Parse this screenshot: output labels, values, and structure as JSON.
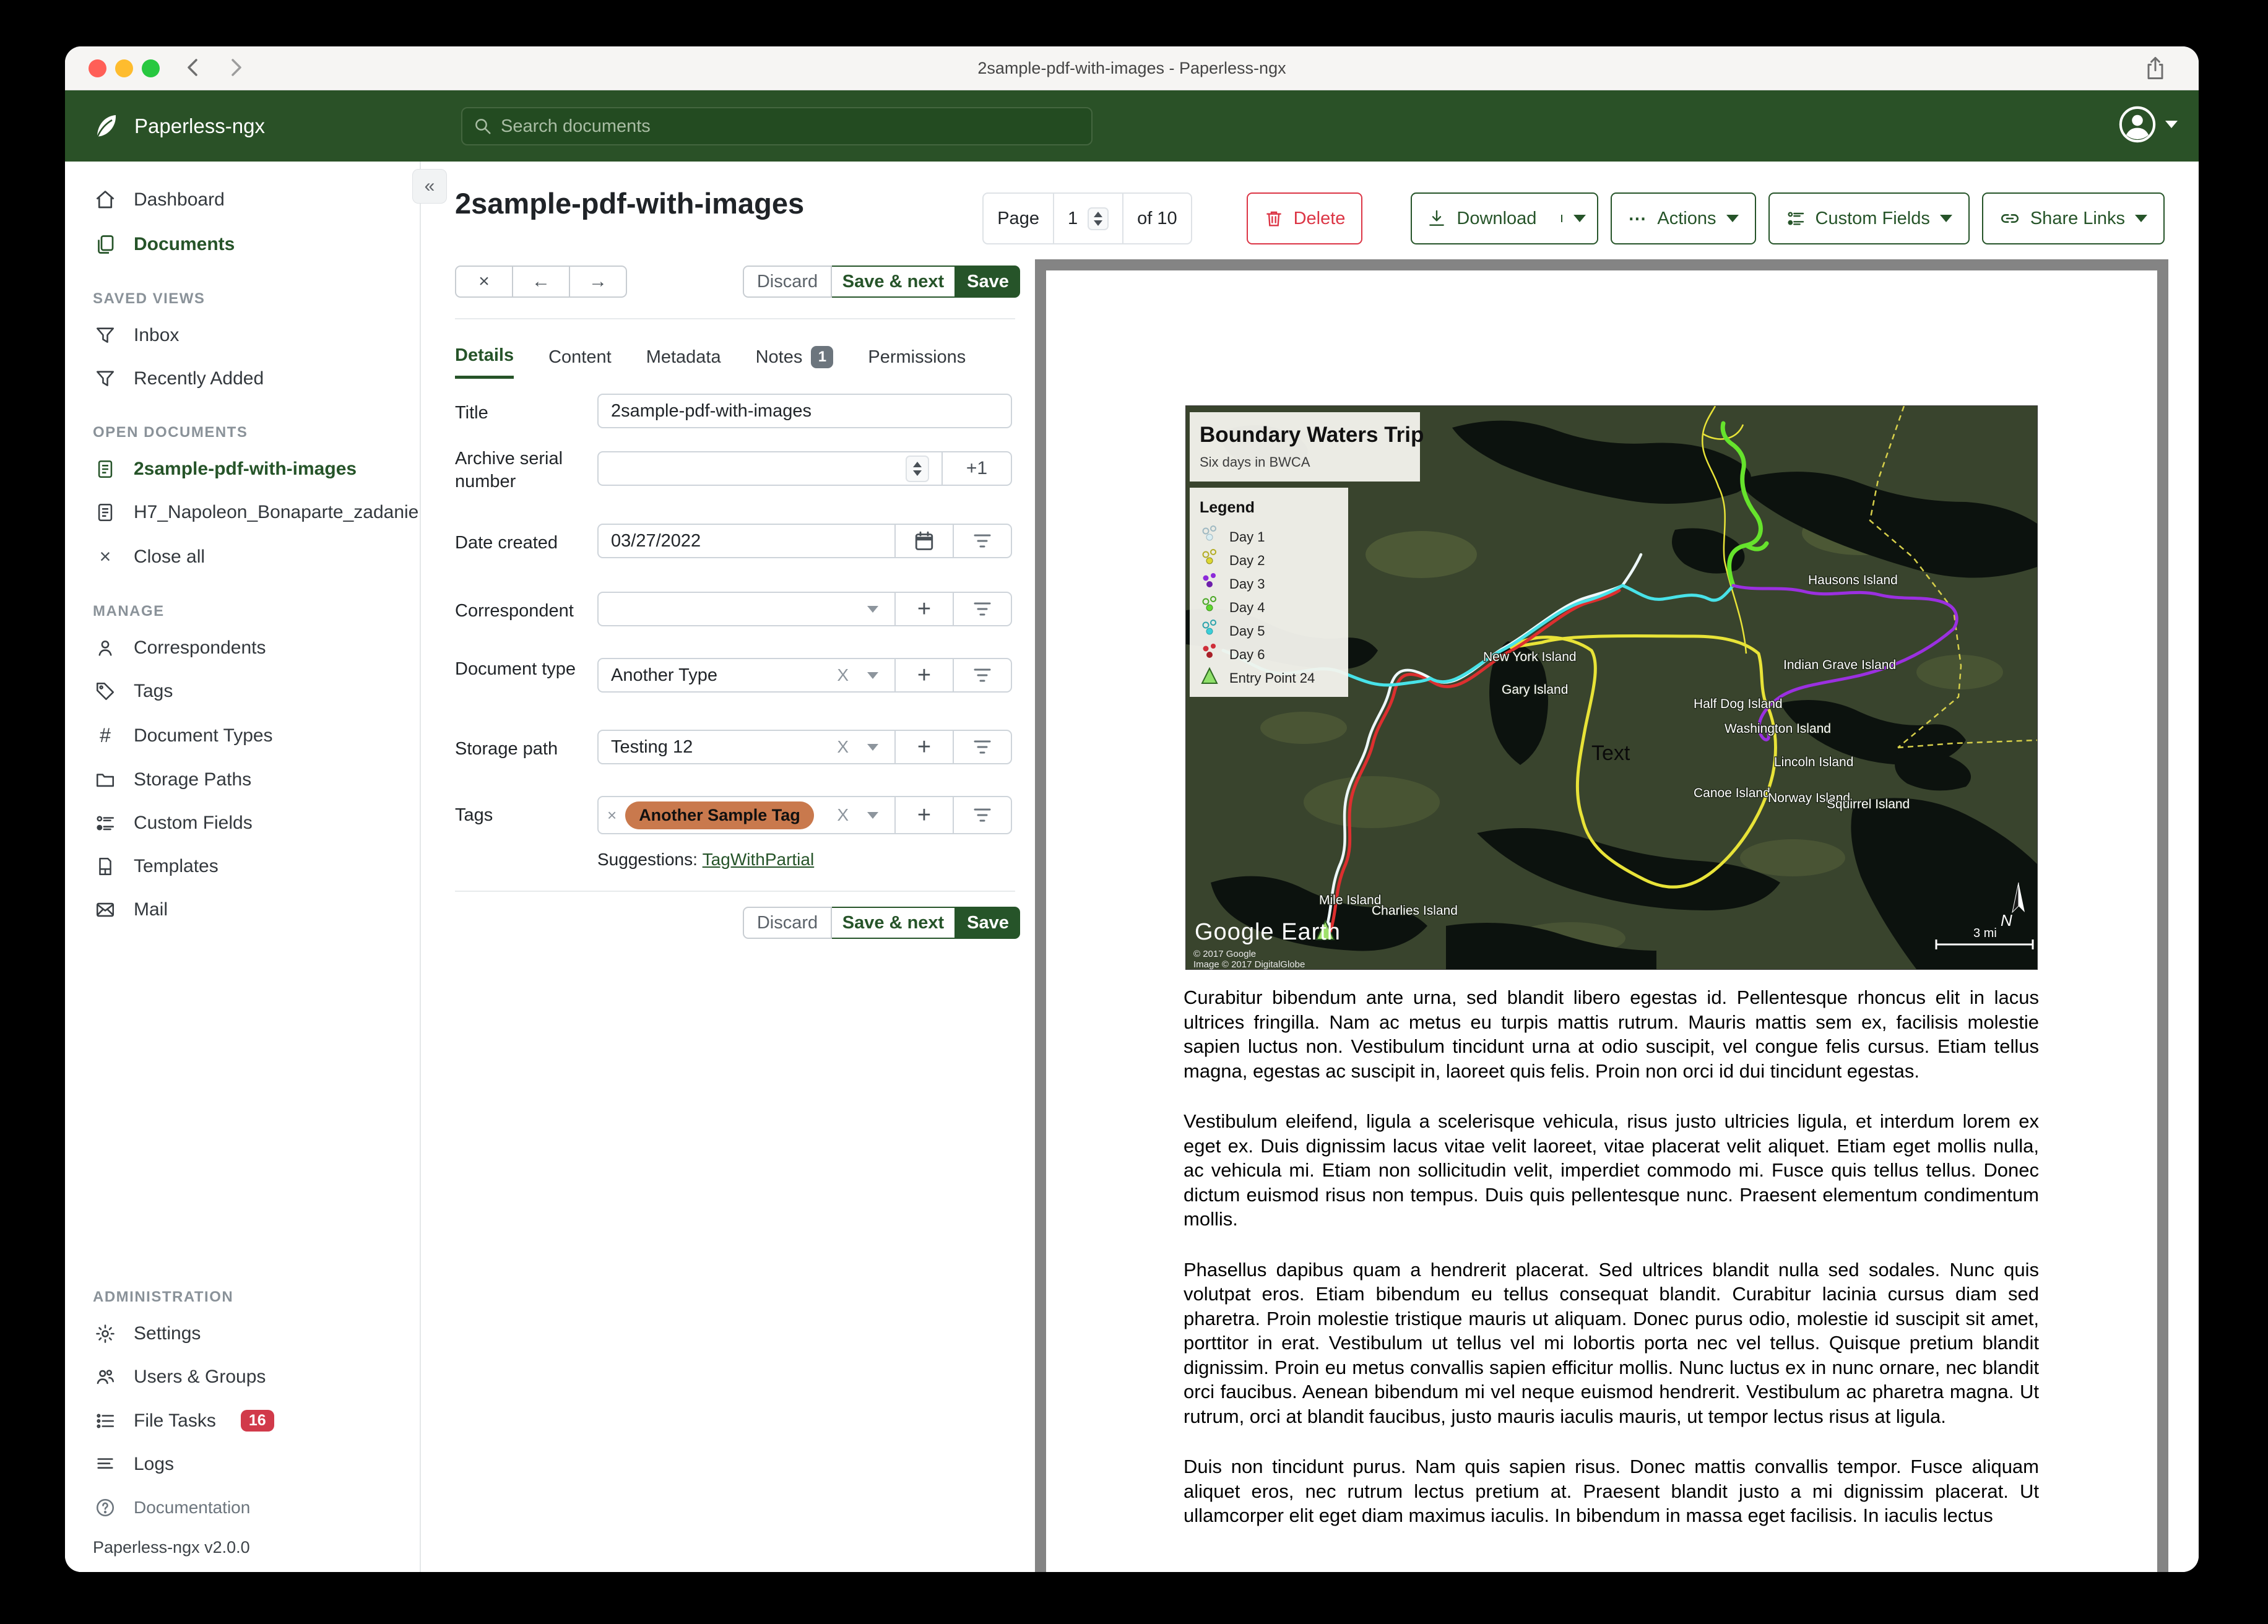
{
  "colors": {
    "brand_green": "#2a5127",
    "primary_green": "#265429",
    "danger_red": "#dc3545",
    "tag_chip": "#c9794d",
    "badge_gray": "#6c757d",
    "frame_gray": "#848484"
  },
  "titlebar": {
    "title": "2sample-pdf-with-images - Paperless-ngx"
  },
  "navbar": {
    "brand": "Paperless-ngx",
    "search_placeholder": "Search documents"
  },
  "sidebar": {
    "dashboard": "Dashboard",
    "documents": "Documents",
    "saved_views_header": "SAVED VIEWS",
    "saved_views": [
      "Inbox",
      "Recently Added"
    ],
    "open_documents_header": "OPEN DOCUMENTS",
    "open_documents": [
      "2sample-pdf-with-images",
      "H7_Napoleon_Bonaparte_zadanie"
    ],
    "close_all": "Close all",
    "manage_header": "MANAGE",
    "manage": [
      "Correspondents",
      "Tags",
      "Document Types",
      "Storage Paths",
      "Custom Fields",
      "Templates",
      "Mail"
    ],
    "admin_header": "ADMINISTRATION",
    "admin": [
      "Settings",
      "Users & Groups",
      "File Tasks",
      "Logs"
    ],
    "file_tasks_badge": "16",
    "documentation": "Documentation",
    "version": "Paperless-ngx v2.0.0"
  },
  "header": {
    "title": "2sample-pdf-with-images",
    "page_label": "Page",
    "page_value": "1",
    "page_of": "of 10",
    "delete": "Delete",
    "download": "Download",
    "actions": "Actions",
    "custom_fields": "Custom Fields",
    "share_links": "Share Links"
  },
  "toolbar": {
    "discard": "Discard",
    "save_next": "Save & next",
    "save": "Save"
  },
  "tabs": {
    "details": "Details",
    "content": "Content",
    "metadata": "Metadata",
    "notes": "Notes",
    "notes_badge": "1",
    "permissions": "Permissions"
  },
  "form": {
    "title_label": "Title",
    "title_value": "2sample-pdf-with-images",
    "asn_label": "Archive serial number",
    "asn_plus": "+1",
    "date_label": "Date created",
    "date_value": "03/27/2022",
    "correspondent_label": "Correspondent",
    "doctype_label": "Document type",
    "doctype_value": "Another Type",
    "storage_label": "Storage path",
    "storage_value": "Testing 12",
    "tags_label": "Tags",
    "tag_chip": "Another Sample Tag",
    "suggestions_label": "Suggestions:",
    "suggestion_link": "TagWithPartial"
  },
  "preview": {
    "map": {
      "title": "Boundary Waters Trip",
      "subtitle": "Six days in BWCA",
      "legend_title": "Legend",
      "legend": [
        {
          "label": "Day 1",
          "color": "#d8edf2"
        },
        {
          "label": "Day 2",
          "color": "#ddd832"
        },
        {
          "label": "Day 3",
          "color": "#8c2bd9"
        },
        {
          "label": "Day 4",
          "color": "#5fd930"
        },
        {
          "label": "Day 5",
          "color": "#3ccfd9"
        },
        {
          "label": "Day 6",
          "color": "#cf2f3a"
        },
        {
          "label": "Entry Point 24",
          "color": "#8fe06a"
        }
      ],
      "labels": [
        "Hausons Island",
        "New York Island",
        "Gary Island",
        "Indian Grave Island",
        "Half Dog Island",
        "Washington Island",
        "Lincoln Island",
        "Canoe Island",
        "Norway Island",
        "Squirrel Island",
        "Mile Island",
        "Charlies Island"
      ],
      "text_label": "Text",
      "credit": "Google Earth",
      "copyright1": "© 2017 Google",
      "copyright2": "Image © 2017 DigitalGlobe",
      "scale": "3 mi",
      "compass": "N"
    },
    "paragraphs": [
      "Curabitur bibendum ante urna, sed blandit libero egestas id. Pellentesque rhoncus elit in lacus ultrices fringilla. Nam ac metus eu turpis mattis rutrum. Mauris mattis sem ex, facilisis molestie sapien luctus non. Vestibulum tincidunt urna at odio suscipit, vel congue felis cursus. Etiam tellus magna, egestas ac suscipit in, laoreet quis felis. Proin non orci id dui tincidunt egestas.",
      "Vestibulum eleifend, ligula a scelerisque vehicula, risus justo ultricies ligula, et interdum lorem ex eget ex. Duis dignissim lacus vitae velit laoreet, vitae placerat velit aliquet. Etiam eget mollis nulla, ac vehicula mi. Etiam non sollicitudin velit, imperdiet commodo mi. Fusce quis tellus tellus. Donec dictum euismod risus non tempus. Duis quis pellentesque nunc. Praesent elementum condimentum mollis.",
      "Phasellus dapibus quam a hendrerit placerat. Sed ultrices blandit nulla sed sodales. Nunc quis volutpat eros. Etiam bibendum eu tellus consequat blandit. Curabitur lacinia cursus diam sed pharetra. Proin molestie tristique mauris ut aliquam. Donec purus odio, molestie id suscipit sit amet, porttitor in erat. Vestibulum ut tellus vel mi lobortis porta nec vel tellus. Quisque pretium blandit dignissim. Proin eu metus convallis sapien efficitur mollis. Nunc luctus ex in nunc ornare, nec blandit orci faucibus. Aenean bibendum mi vel neque euismod hendrerit. Vestibulum ac pharetra magna. Ut rutrum, orci at blandit faucibus, justo mauris iaculis mauris, ut tempor lectus risus at ligula.",
      "Duis non tincidunt purus. Nam quis sapien risus. Donec mattis convallis tempor. Fusce aliquam aliquet eros, nec rutrum lectus pretium at. Praesent blandit justo a mi dignissim placerat. Ut ullamcorper elit eget diam maximus iaculis. In bibendum in massa eget facilisis. In iaculis lectus"
    ]
  }
}
